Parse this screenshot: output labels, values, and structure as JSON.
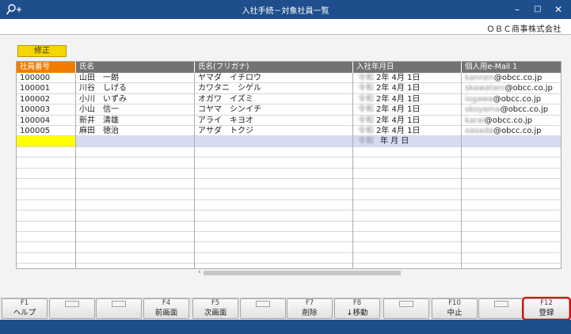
{
  "window": {
    "title": "入社手続－対象社員一覧",
    "company": "ＯＢＣ商事株式会社"
  },
  "toolbar": {
    "edit_label": "修正"
  },
  "table": {
    "headers": [
      "社員番号",
      "氏名",
      "氏名(フリガナ)",
      "入社年月日",
      "個人用e-Mail 1"
    ],
    "rows": [
      {
        "id": "100000",
        "name": "山田　一朗",
        "kana": "ヤマダ　イチロウ",
        "era": "令和",
        "date": "2年  4月  1日",
        "mail_user": "kannen",
        "mail_domain": "@obcc.co.jp"
      },
      {
        "id": "100001",
        "name": "川谷　しげる",
        "kana": "カワタニ　シゲル",
        "era": "令和",
        "date": "2年  4月  1日",
        "mail_user": "skawatani",
        "mail_domain": "@obcc.co.jp"
      },
      {
        "id": "100002",
        "name": "小川　いずみ",
        "kana": "オガワ　イズミ",
        "era": "令和",
        "date": "2年  4月  1日",
        "mail_user": "iogawa",
        "mail_domain": "@obcc.co.jp"
      },
      {
        "id": "100003",
        "name": "小山　信一",
        "kana": "コヤマ　シンイチ",
        "era": "令和",
        "date": "2年  4月  1日",
        "mail_user": "skoyama",
        "mail_domain": "@obcc.co.jp"
      },
      {
        "id": "100004",
        "name": "新井　清雄",
        "kana": "アライ　キヨオ",
        "era": "令和",
        "date": "2年  4月  1日",
        "mail_user": "karai",
        "mail_domain": "@obcc.co.jp"
      },
      {
        "id": "100005",
        "name": "麻田　徳治",
        "kana": "アサダ　トクジ",
        "era": "令和",
        "date": "2年  4月  1日",
        "mail_user": "oasada",
        "mail_domain": "@obcc.co.jp"
      }
    ],
    "new_row": {
      "era": "令和",
      "date": "年    月    日"
    }
  },
  "fkeys": [
    {
      "num": "F1",
      "label": "ヘルプ"
    },
    {
      "num": "",
      "label": ""
    },
    {
      "num": "",
      "label": ""
    },
    {
      "num": "F4",
      "label": "前画面"
    },
    {
      "num": "F5",
      "label": "次画面"
    },
    {
      "num": "",
      "label": ""
    },
    {
      "num": "F7",
      "label": "削除"
    },
    {
      "num": "F8",
      "label": "↓移動"
    },
    {
      "num": "",
      "label": ""
    },
    {
      "num": "F10",
      "label": "中止"
    },
    {
      "num": "",
      "label": ""
    },
    {
      "num": "F12",
      "label": "登録"
    }
  ],
  "colors": {
    "titlebar": "#1e4f8c",
    "header_gray": "#737373",
    "header_active": "#f07d00",
    "edit_button": "#f5d600",
    "selected_row": "#d6dbf2",
    "highlight": "#e00000"
  },
  "icons": {
    "app_icon": "key-search-icon",
    "minimize": "minimize-icon",
    "maximize": "maximize-icon",
    "close": "close-icon"
  }
}
